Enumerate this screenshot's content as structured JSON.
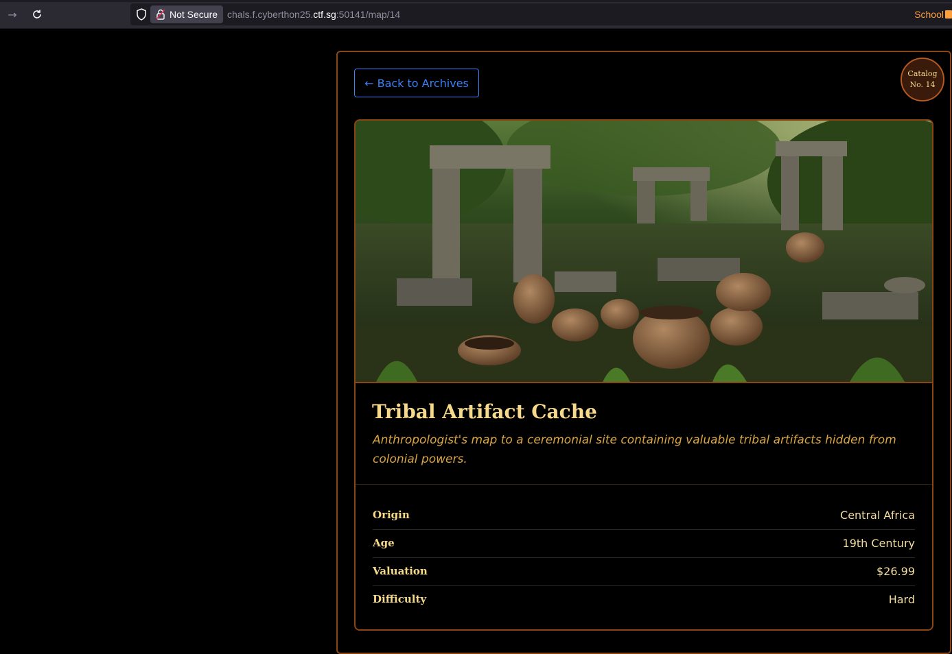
{
  "browser": {
    "security_label": "Not Secure",
    "url_prefix": "chals.f.cyberthon25.",
    "url_host": "ctf.sg",
    "url_suffix": ":50141/map/14",
    "bookmark_label": "School"
  },
  "page": {
    "back_label": "← Back to Archives",
    "catalog_line1": "Catalog",
    "catalog_line2": "No. 14",
    "title": "Tribal Artifact Cache",
    "subtitle": "Anthropologist's map to a ceremonial site containing valuable tribal artifacts hidden from colonial powers.",
    "details": [
      {
        "label": "Origin",
        "value": "Central Africa"
      },
      {
        "label": "Age",
        "value": "19th Century"
      },
      {
        "label": "Valuation",
        "value": "$26.99"
      },
      {
        "label": "Difficulty",
        "value": "Hard"
      }
    ]
  },
  "colors": {
    "accent_gold": "#f6d98a",
    "subtitle_amber": "#d9a441",
    "border_brown": "#8b4513",
    "link_blue": "#3b82f6"
  }
}
